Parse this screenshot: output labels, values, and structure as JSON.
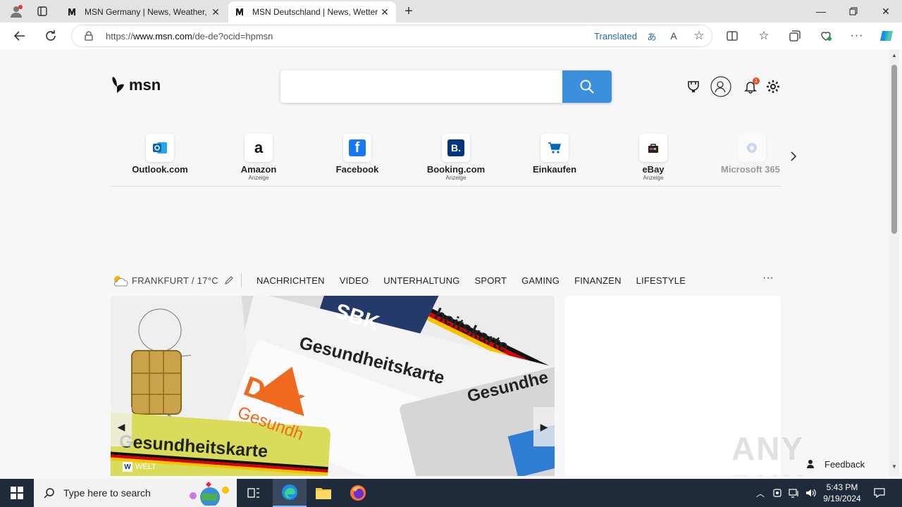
{
  "browser": {
    "tabs": [
      {
        "title": "MSN Germany | News, Weather,",
        "active": false
      },
      {
        "title": "MSN Deutschland | News, Wetter",
        "active": true
      }
    ],
    "url_prefix": "https://",
    "url_host": "www.msn.com",
    "url_path": "/de-de?ocid=hpmsn",
    "translated_label": "Translated"
  },
  "msn": {
    "logo_text": "msn",
    "search_placeholder": "",
    "notification_count": "1",
    "quicklinks": [
      {
        "label": "Outlook.com",
        "sub": ""
      },
      {
        "label": "Amazon",
        "sub": "Anzeige"
      },
      {
        "label": "Facebook",
        "sub": ""
      },
      {
        "label": "Booking.com",
        "sub": "Anzeige"
      },
      {
        "label": "Einkaufen",
        "sub": ""
      },
      {
        "label": "eBay",
        "sub": "Anzeige"
      },
      {
        "label": "Microsoft 365",
        "sub": ""
      }
    ],
    "weather": "FRANKFURT / 17°C",
    "nav": [
      "NACHRICHTEN",
      "VIDEO",
      "UNTERHALTUNG",
      "SPORT",
      "GAMING",
      "FINANZEN",
      "LIFESTYLE"
    ],
    "hero": {
      "source": "WELT",
      "card_texts": [
        "SBK",
        "Gesundheitskarte",
        "Gesundheitskarte",
        "DAK",
        "Gesundh",
        "Gesundheitskarte",
        "Gesundhe",
        "heitskarte"
      ]
    },
    "feedback_label": "Feedback",
    "watermark": "ANY RUN"
  },
  "taskbar": {
    "search_placeholder": "Type here to search",
    "time": "5:43 PM",
    "date": "9/19/2024"
  },
  "colors": {
    "accent": "#3b8fdd",
    "taskbar": "#1f2b3a",
    "notification": "#e0542a"
  }
}
